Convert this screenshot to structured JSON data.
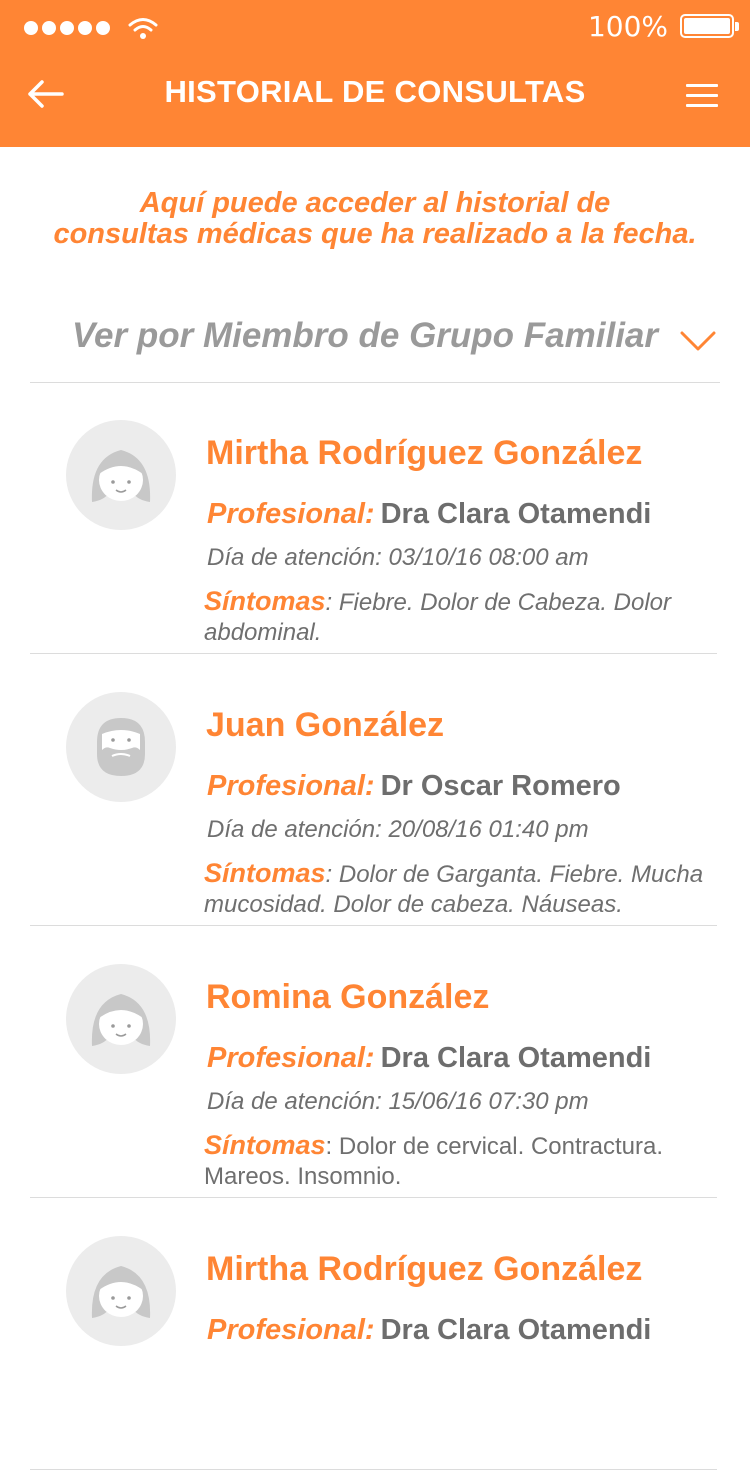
{
  "status_bar": {
    "battery_text": "100%",
    "signal_icon": "signal-dots-icon",
    "wifi_icon": "wifi-icon",
    "battery_icon": "battery-icon"
  },
  "header": {
    "title": "HISTORIAL DE CONSULTAS",
    "back_icon": "back-arrow-icon",
    "menu_icon": "hamburger-menu-icon",
    "background_color": "#FF8534"
  },
  "intro": {
    "line1": "Aquí puede acceder al historial de",
    "line2": "consultas médicas que ha realizado a la fecha."
  },
  "filter": {
    "label": "Ver por Miembro de Grupo Familiar",
    "icon": "chevron-down-icon"
  },
  "labels": {
    "professional": "Profesional:",
    "symptoms": "Síntomas"
  },
  "consultations": [
    {
      "avatar": "female",
      "name": "Mirtha Rodríguez González",
      "professional": "Dra Clara Otamendi",
      "date": "Día de atención: 03/10/16 08:00 am",
      "symptoms": ": Fiebre. Dolor de Cabeza. Dolor abdominal."
    },
    {
      "avatar": "male",
      "name": "Juan González",
      "professional": "Dr Oscar Romero",
      "date": "Día de atención: 20/08/16 01:40 pm",
      "symptoms": ": Dolor de Garganta. Fiebre. Mucha mucosidad. Dolor de cabeza. Náuseas."
    },
    {
      "avatar": "female",
      "name": "Romina González",
      "professional": "Dra Clara Otamendi",
      "date": "Día de atención: 15/06/16 07:30 pm",
      "symptoms": ": Dolor de cervical. Contractura. Mareos. Insomnio."
    },
    {
      "avatar": "female",
      "name": "Mirtha Rodríguez González",
      "professional": "Dra Clara Otamendi",
      "date": "",
      "symptoms": ""
    }
  ]
}
